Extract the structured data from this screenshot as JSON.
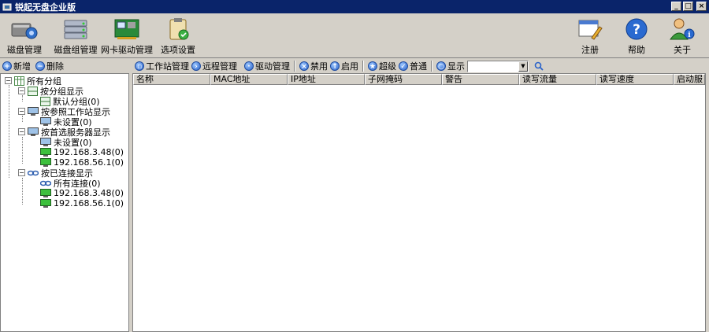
{
  "window": {
    "title": "锐起无盘企业版"
  },
  "toolbar": {
    "disk_mgmt": "磁盘管理",
    "disk_group_mgmt": "磁盘组管理",
    "nic_driver_mgmt": "网卡驱动管理",
    "options": "选项设置",
    "register": "注册",
    "help": "帮助",
    "about": "关于"
  },
  "left_toolbar": {
    "add": "新增",
    "delete": "删除"
  },
  "tree": {
    "root": "所有分组",
    "by_group": "按分组显示",
    "default_group": "默认分组(0)",
    "by_ref_station": "按参照工作站显示",
    "unset_1": "未设置(0)",
    "by_pref_server": "按首选服务器显示",
    "unset_2": "未设置(0)",
    "srv_a": "192.168.3.48(0)",
    "srv_b": "192.168.56.1(0)",
    "by_connected": "按已连接显示",
    "all_conn": "所有连接(0)",
    "conn_a": "192.168.3.48(0)",
    "conn_b": "192.168.56.1(0)"
  },
  "right_toolbar": {
    "station_mgmt": "工作站管理",
    "remote_mgmt": "远程管理",
    "driver_mgmt": "驱动管理",
    "disable": "禁用",
    "enable": "启用",
    "super": "超级",
    "normal": "普通",
    "show": "显示"
  },
  "grid": {
    "columns": [
      "名称",
      "MAC地址",
      "IP地址",
      "子网掩码",
      "警告",
      "读写流量",
      "读写速度",
      "启动服"
    ]
  }
}
